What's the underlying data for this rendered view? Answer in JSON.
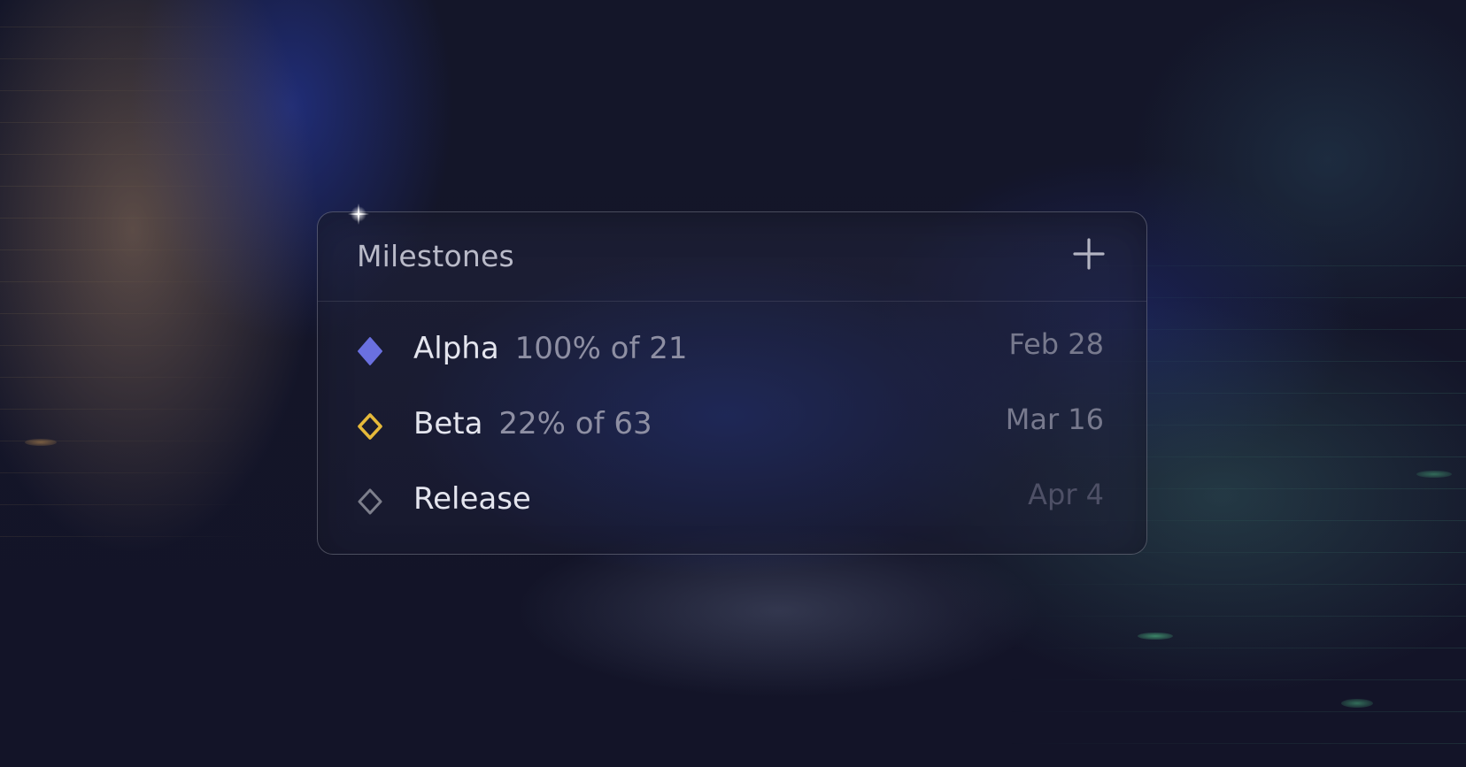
{
  "panel": {
    "title": "Milestones",
    "add_icon": "plus-icon"
  },
  "milestones": [
    {
      "name": "Alpha",
      "progress": "100% of 21",
      "date": "Feb 28",
      "icon": "filled-diamond-icon",
      "color": "#6a70e0"
    },
    {
      "name": "Beta",
      "progress": "22% of 63",
      "date": "Mar 16",
      "icon": "outline-diamond-icon",
      "color": "#e5b93a"
    },
    {
      "name": "Release",
      "progress": "",
      "date": "Apr 4",
      "icon": "outline-diamond-icon",
      "color": "#7d7f8c"
    }
  ]
}
